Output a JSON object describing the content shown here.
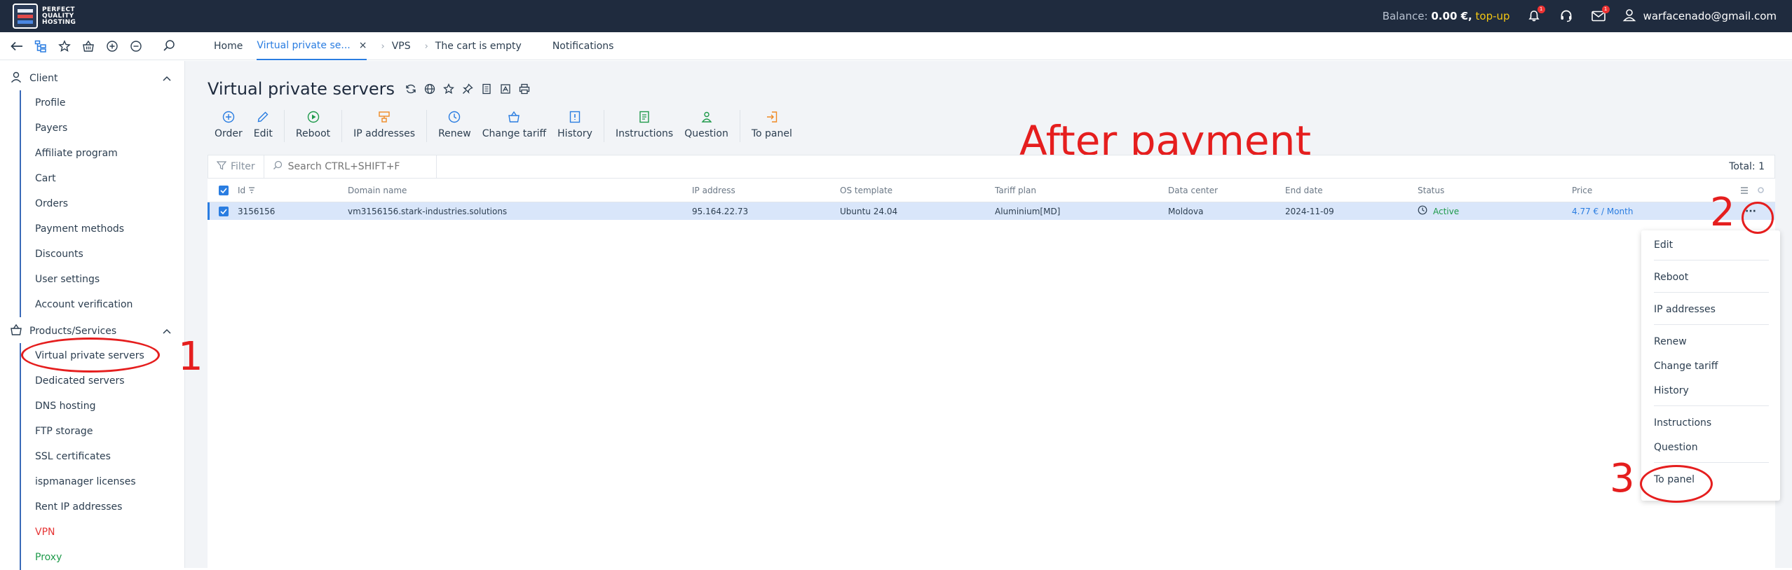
{
  "topbar": {
    "logo_text": "PERFECT QUALITY HOSTING",
    "balance_label": "Balance:",
    "balance_value": "0.00 €,",
    "topup": "top-up",
    "notifications_badge": "1",
    "mail_badge": "1",
    "user_email": "warfacenado@gmail.com"
  },
  "tabs": {
    "home": "Home",
    "vps_tab": "Virtual private se...",
    "close": "×",
    "vps": "VPS",
    "cart": "The cart is empty",
    "notifications": "Notifications"
  },
  "sidebar": {
    "client_label": "Client",
    "client_items": [
      "Profile",
      "Payers",
      "Affiliate program",
      "Cart",
      "Orders",
      "Payment methods",
      "Discounts",
      "User settings",
      "Account verification"
    ],
    "products_label": "Products/Services",
    "product_items": [
      "Virtual private servers",
      "Dedicated servers",
      "DNS hosting",
      "FTP storage",
      "SSL certificates",
      "ispmanager licenses",
      "Rent IP addresses",
      "VPN",
      "Proxy"
    ]
  },
  "main": {
    "title": "Virtual private servers",
    "toolbar": [
      "Order",
      "Edit",
      "Reboot",
      "IP addresses",
      "Renew",
      "Change tariff",
      "History",
      "Instructions",
      "Question",
      "To panel"
    ],
    "annotation_title": "After payment",
    "filter_label": "Filter",
    "search_placeholder": "Search CTRL+SHIFT+F",
    "total": "Total: 1"
  },
  "table": {
    "headers": [
      "Id",
      "Domain name",
      "IP address",
      "OS template",
      "Tariff plan",
      "Data center",
      "End date",
      "Status",
      "Price"
    ],
    "row": {
      "id": "3156156",
      "domain": "vm3156156.stark-industries.solutions",
      "ip": "95.164.22.73",
      "os": "Ubuntu 24.04",
      "tariff": "Aluminium[MD]",
      "datacenter": "Moldova",
      "end_date": "2024-11-09",
      "status": "Active",
      "price": "4.77 € / Month"
    },
    "more": "···"
  },
  "dropdown": {
    "items": [
      "Edit",
      "Reboot",
      "IP addresses",
      "Renew",
      "Change tariff",
      "History",
      "Instructions",
      "Question",
      "To panel"
    ]
  },
  "annotations": {
    "n1": "1",
    "n2": "2",
    "n3": "3"
  },
  "colors": {
    "topbar_bg": "#1f2b3e",
    "accent": "#2a7de1",
    "annotation_red": "#e51e1e",
    "status_green": "#1f9a4b",
    "vpn_red": "#e63535",
    "topup_yellow": "#f3c613"
  }
}
